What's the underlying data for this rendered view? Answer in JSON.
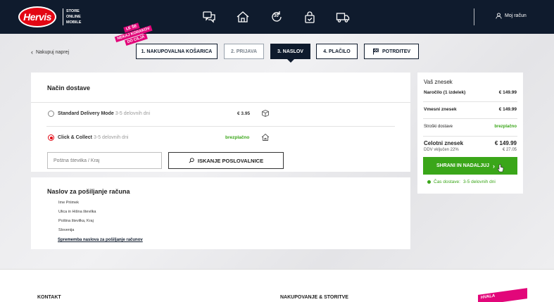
{
  "header": {
    "logo_text": "Hervis",
    "store_lines": [
      "STORE",
      "ONLINE",
      "MOBILE"
    ],
    "icons": [
      "chat-icon",
      "home-icon",
      "return-30-icon",
      "secure-bag-icon",
      "truck-icon"
    ],
    "return_days": "30",
    "account_label": "Moj račun"
  },
  "breadcrumb": {
    "back_label": "Nakupuj naprej"
  },
  "ribbon": [
    "LE ŠE",
    "NEKAJ KORAKOV",
    "DO CILJA"
  ],
  "steps": [
    {
      "label": "1. NAKUPOVALNA KOŠARICA",
      "state": "done"
    },
    {
      "label": "2. PRIJAVA",
      "state": "muted"
    },
    {
      "label": "3. NASLOV",
      "state": "active"
    },
    {
      "label": "4. PLAČILO",
      "state": "done"
    },
    {
      "label": "POTRDITEV",
      "state": "done"
    }
  ],
  "delivery": {
    "title": "Način dostave",
    "options": [
      {
        "name": "Standard Delivery Mode",
        "days": "3-5 delovnih dni",
        "price": "€ 3.95",
        "selected": false
      },
      {
        "name": "Click & Collect",
        "days": "3-5 delovnih dni",
        "price": "brezplačno",
        "selected": true
      }
    ],
    "zip_placeholder": "Poštna številka / Kraj",
    "search_button": "ISKANJE POSLOVALNICE"
  },
  "invoice": {
    "title": "Naslov za pošiljanje računa",
    "lines": [
      "Ime Priimek",
      "Ulica in Hišna številka",
      "Poštna številka, Kraj",
      "Slovenija"
    ],
    "change_link": "Sprememba naslova za pošiljanje računov"
  },
  "summary": {
    "title": "Vaš znesek",
    "order_label": "Naročilo (1 izdelek)",
    "order_value": "€ 149.99",
    "subtotal_label": "Vmesni znesek",
    "subtotal_value": "€ 149.99",
    "shipping_label": "Stroški dostave",
    "shipping_value": "brezplačno",
    "total_label": "Celotni znesek",
    "total_value": "€ 149.99",
    "vat_label": "DDV vključen 22%",
    "vat_value": "€ 27.05",
    "save_button": "SHRANI IN NADALJUJ",
    "delivery_time_label": "Čas dostave:",
    "delivery_time_value": "3-5 delovnih dni"
  },
  "footer": {
    "col1": "KONTAKT",
    "col2": "NAKUPOVANJE & STORITVE",
    "badge": "HVALA"
  },
  "colors": {
    "navy": "#0f1b2d",
    "brand_red": "#e30613",
    "ribbon_pink": "#e2077a",
    "success_green": "#3aa619"
  }
}
